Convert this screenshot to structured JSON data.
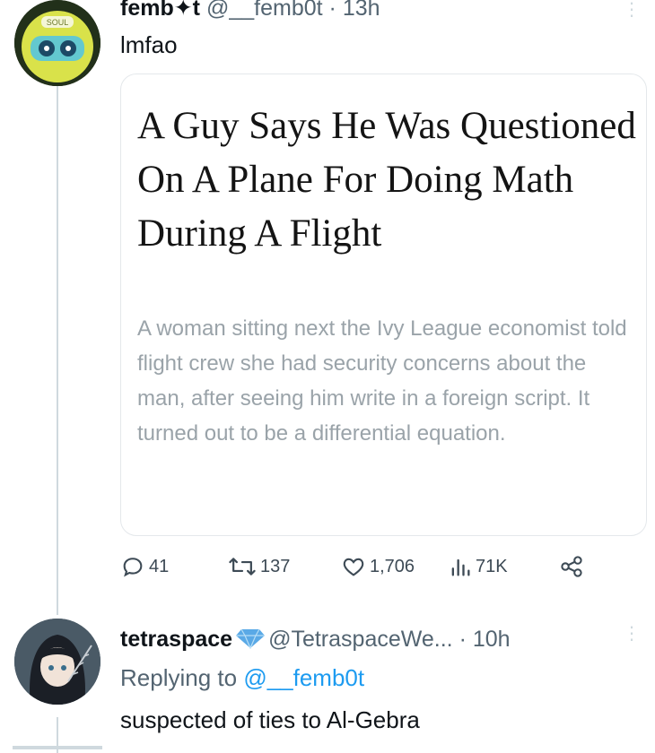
{
  "tweet1": {
    "display_name": "femb✦t",
    "handle": "@__femb0t",
    "separator": "·",
    "time": "13h",
    "text": "lmfao",
    "avatar_text": "SOUL",
    "card": {
      "title": "A Guy Says He Was Questioned On A Plane For Doing Math During A Flight",
      "description": "A woman sitting next the Ivy League economist told flight crew she had security concerns about the man, after seeing him write in a foreign script. It turned out to be a differential equation."
    },
    "actions": {
      "replies": "41",
      "retweets": "137",
      "likes": "1,706",
      "views": "71K"
    }
  },
  "tweet2": {
    "display_name": "tetraspace",
    "handle": "@TetraspaceWe...",
    "separator": "·",
    "time": "10h",
    "replying_label": "Replying to",
    "replying_handle": "@__femb0t",
    "text": "suspected of ties to Al-Gebra"
  },
  "colors": {
    "link": "#1d9bf0",
    "muted": "#536471",
    "verified": "#5aa9e6"
  }
}
